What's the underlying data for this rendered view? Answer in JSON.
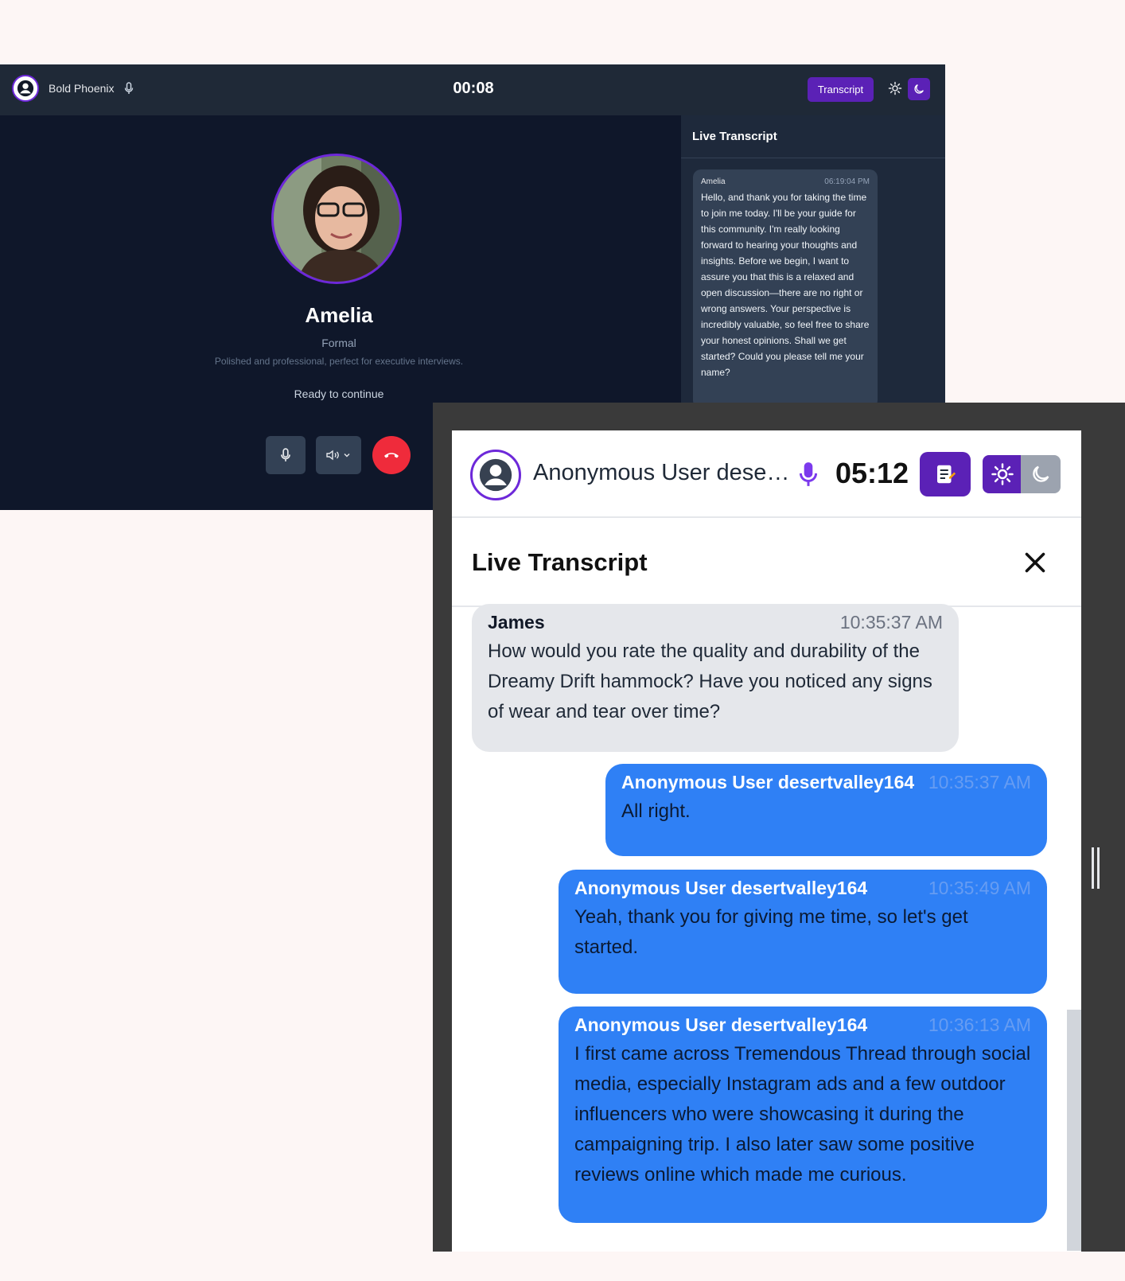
{
  "desktop": {
    "header": {
      "user_name": "Bold Phoenix",
      "timer": "00:08",
      "transcript_button": "Transcript"
    },
    "agent": {
      "name": "Amelia",
      "style": "Formal",
      "description": "Polished and professional, perfect for executive interviews.",
      "status": "Ready to continue"
    },
    "transcript": {
      "title": "Live Transcript",
      "messages": [
        {
          "speaker": "Amelia",
          "time": "06:19:04 PM",
          "text": "Hello, and thank you for taking the time to join me today. I'll be your guide for this community. I'm really looking forward to hearing your thoughts and insights. Before we begin, I want to assure you that this is a relaxed and open discussion—there are no right or wrong answers. Your perspective is incredibly valuable, so feel free to share your honest opinions. Shall we get started? Could you please tell me your name?"
        }
      ]
    }
  },
  "mobile": {
    "header": {
      "user_name": "Anonymous User dese…",
      "timer": "05:12"
    },
    "transcript": {
      "title": "Live Transcript",
      "messages": [
        {
          "speaker": "James",
          "time": "10:35:37 AM",
          "text": "How would you rate the quality and durability of the Dreamy Drift hammock? Have you noticed any signs of wear and tear over time?"
        },
        {
          "speaker": "Anonymous User desertvalley164",
          "time": "10:35:37 AM",
          "text": "All right."
        },
        {
          "speaker": "Anonymous User desertvalley164",
          "time": "10:35:49 AM",
          "text": "Yeah, thank you for giving me time, so let's get started."
        },
        {
          "speaker": "Anonymous User desertvalley164",
          "time": "10:36:13 AM",
          "text": "I first came across Tremendous Thread through social media, especially Instagram ads and a few outdoor influencers who were showcasing it during the campaigning trip. I also later saw some positive reviews online which made me curious."
        }
      ]
    }
  },
  "colors": {
    "accent_purple": "#5b21b6",
    "bubble_blue": "#2f80f5",
    "end_call_red": "#ef2b3b",
    "dark_bg": "#0f172a"
  },
  "icons": [
    "user-icon",
    "mic-icon",
    "sun-icon",
    "moon-icon",
    "speaker-icon",
    "chevron-down-icon",
    "phone-hangup-icon",
    "notes-icon",
    "close-icon"
  ]
}
